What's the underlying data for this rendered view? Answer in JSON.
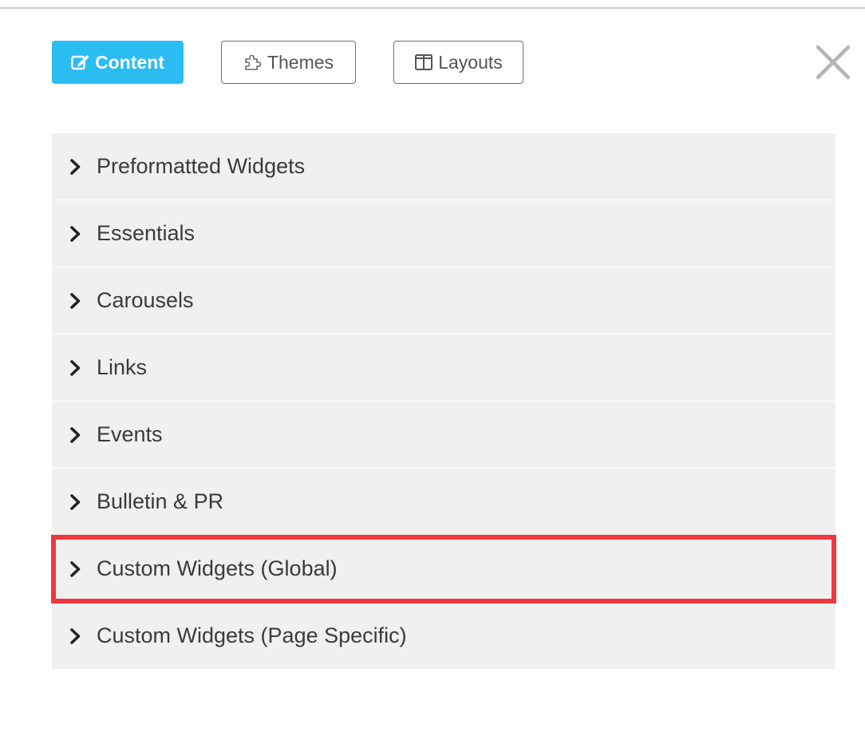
{
  "toolbar": {
    "tabs": [
      {
        "label": "Content",
        "icon": "edit-icon",
        "active": true
      },
      {
        "label": "Themes",
        "icon": "puzzle-icon",
        "active": false
      },
      {
        "label": "Layouts",
        "icon": "columns-icon",
        "active": false
      }
    ],
    "close_icon": "close-icon"
  },
  "accordion": {
    "items": [
      {
        "label": "Preformatted Widgets"
      },
      {
        "label": "Essentials"
      },
      {
        "label": "Carousels"
      },
      {
        "label": "Links"
      },
      {
        "label": "Events"
      },
      {
        "label": "Bulletin & PR"
      },
      {
        "label": "Custom Widgets (Global)",
        "highlighted": true
      },
      {
        "label": "Custom Widgets (Page Specific)"
      }
    ]
  },
  "colors": {
    "accent": "#2bbdf2",
    "highlight": "#f0373f",
    "item_background": "#f0f0f0",
    "rule": "#c9c9cf"
  }
}
